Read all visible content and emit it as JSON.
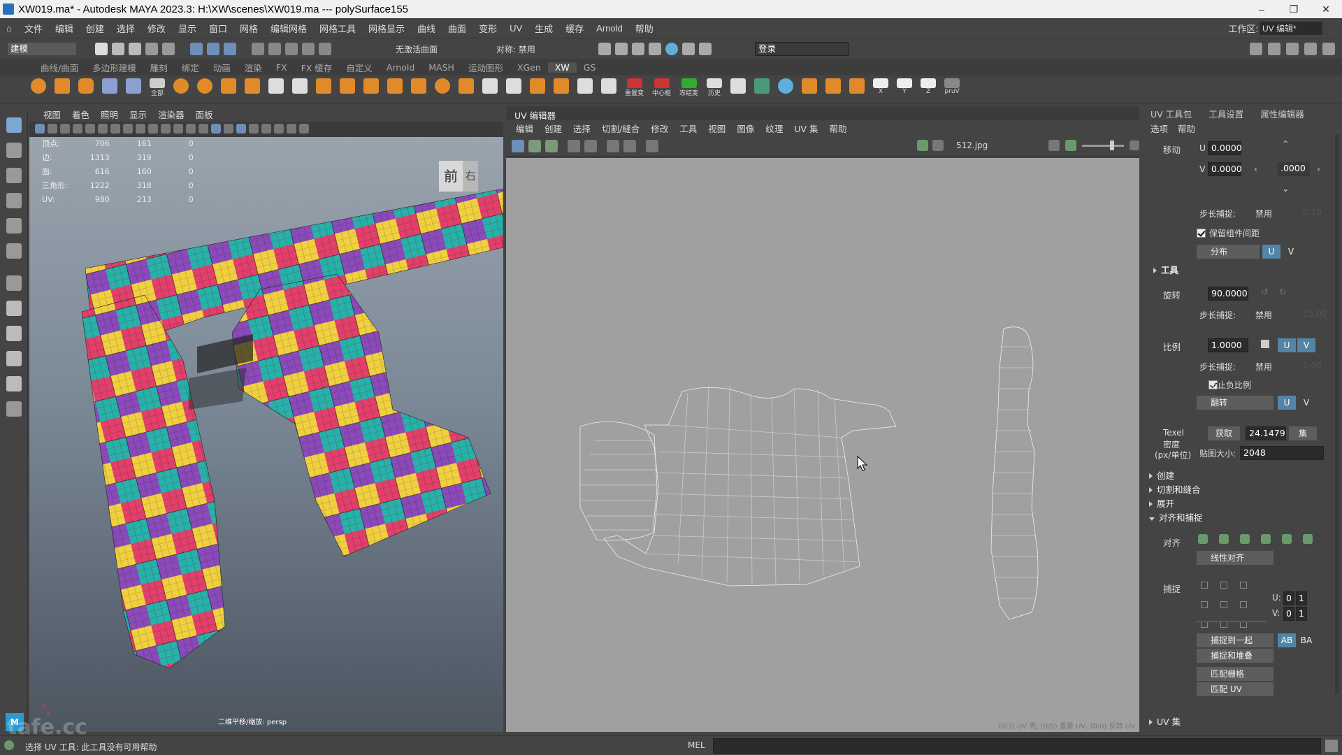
{
  "window": {
    "title": "XW019.ma* - Autodesk MAYA 2023.3: H:\\XW\\scenes\\XW019.ma   ---   polySurface155",
    "min": "–",
    "max": "❐",
    "close": "✕"
  },
  "menubar": {
    "items": [
      "文件",
      "编辑",
      "创建",
      "选择",
      "修改",
      "显示",
      "窗口",
      "网格",
      "编辑网格",
      "网格工具",
      "网格显示",
      "曲线",
      "曲面",
      "变形",
      "UV",
      "生成",
      "缓存",
      "Arnold",
      "帮助"
    ],
    "workspace_label": "工作区:",
    "workspace_value": "UV 编辑*"
  },
  "toolbar": {
    "mode": "建模",
    "live_surface": "无激活曲面",
    "symmetry": "对称: 禁用",
    "login": "登录"
  },
  "shelf": {
    "tabs": [
      "曲线/曲面",
      "多边形建模",
      "雕刻",
      "绑定",
      "动画",
      "渲染",
      "FX",
      "FX 缓存",
      "自定义",
      "Arnold",
      "MASH",
      "运动图形",
      "XGen",
      "XW",
      "GS"
    ],
    "active_tab": "XW",
    "labels": [
      "全部",
      "重置变",
      "中心枢",
      "冻结变",
      "历史",
      "X",
      "Y",
      "Z",
      "X",
      "Y",
      "Z",
      "pruV"
    ]
  },
  "viewport": {
    "menu": [
      "视图",
      "着色",
      "照明",
      "显示",
      "渲染器",
      "面板"
    ],
    "hud_rows": [
      [
        "顶点:",
        "706",
        "161",
        "0"
      ],
      [
        "边:",
        "1313",
        "319",
        "0"
      ],
      [
        "面:",
        "616",
        "160",
        "0"
      ],
      [
        "三角形:",
        "1222",
        "318",
        "0"
      ],
      [
        "UV:",
        "980",
        "213",
        "0"
      ]
    ],
    "viewcube": [
      "前",
      "右"
    ],
    "camera_label": "二维平移/缩放: persp"
  },
  "uv_editor": {
    "title": "UV 编辑器",
    "menu": [
      "编辑",
      "创建",
      "选择",
      "切割/缝合",
      "修改",
      "工具",
      "视图",
      "图像",
      "纹理",
      "UV 集",
      "帮助"
    ],
    "texture_name": "512.jpg",
    "status": "(0/3) UV 壳, (0/0) 重叠 UV, (0/0) 反转 UV"
  },
  "uv_toolkit": {
    "tabs": [
      "UV 工具包",
      "工具设置",
      "属性编辑器"
    ],
    "submenu": [
      "选项",
      "帮助"
    ],
    "move": {
      "label": "移动",
      "u_label": "U",
      "u": "0.0000",
      "v_label": "V",
      "v": "0.0000",
      "step": ".0000",
      "step_snap_label": "步长捕捉:",
      "step_snap": "禁用",
      "step_snap_value": "0.10"
    },
    "preserve_spacing": "保留组件间距",
    "distribute": "分布",
    "tools_section": "工具",
    "rotate": {
      "label": "旋转",
      "value": "90.0000",
      "step_snap_label": "步长捕捉:",
      "step_snap": "禁用",
      "step_snap_value": "15.00"
    },
    "scale": {
      "label": "比例",
      "value": "1.0000",
      "step_snap_label": "步长捕捉:",
      "step_snap": "禁用",
      "step_snap_value": "1.00"
    },
    "prevent_negative": "防止负比例",
    "flip": "翻转",
    "texel": {
      "label1": "Texel",
      "label2": "密度",
      "label3": "(px/单位)",
      "get": "获取",
      "value": "24.1479",
      "set": "集",
      "map_size_label": "贴图大小:",
      "map_size": "2048"
    },
    "sections": [
      "创建",
      "切割和缝合",
      "展开",
      "对齐和捕捉"
    ],
    "align_label": "对齐",
    "linear_align": "线性对齐",
    "snap_label": "捕捉",
    "snap_u_label": "U:",
    "snap_v_label": "V:",
    "snap_u": [
      "0",
      "1"
    ],
    "snap_v": [
      "0",
      "1"
    ],
    "snap_together": "捕捉到一起",
    "ab": "AB",
    "ba": "BA",
    "snap_stack": "捕捉和堆叠",
    "match_grid": "匹配栅格",
    "match_uv": "匹配 UV",
    "uv_sets": "UV 集",
    "u": "U",
    "v": "V"
  },
  "statusbar": {
    "help": "选择 UV 工具: 此工具没有可用帮助",
    "mel": "MEL",
    "watermark": "tafe.cc"
  },
  "colors": {
    "accent": "#5285a6",
    "uv_bg": "#a0a0a0"
  }
}
